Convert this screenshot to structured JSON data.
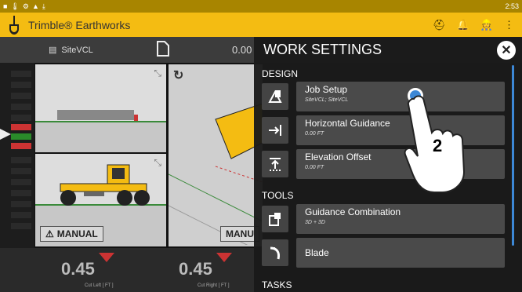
{
  "status": {
    "time": "2:53"
  },
  "app": {
    "title": "Trimble® Earthworks"
  },
  "toolbar": {
    "design_name": "SiteVCL",
    "value": "0.00"
  },
  "views": {
    "left_mode": "MANUAL",
    "right_mode": "MANU"
  },
  "bottom": {
    "cut_left": {
      "value": "0.45",
      "label": "Cut Left  [ FT ]"
    },
    "cut_right": {
      "value": "0.45",
      "label": "Cut Right  [ FT ]"
    }
  },
  "panel": {
    "title": "WORK SETTINGS",
    "sections": {
      "design": "DESIGN",
      "tools": "TOOLS",
      "tasks": "TASKS"
    },
    "items": [
      {
        "label": "Job Setup",
        "sub": "SiteVCL; SiteVCL",
        "icon": "job-setup-icon"
      },
      {
        "label": "Horizontal Guidance",
        "sub": "0.00 FT",
        "icon": "horizontal-guidance-icon"
      },
      {
        "label": "Elevation Offset",
        "sub": "0.00 FT",
        "icon": "elevation-offset-icon"
      },
      {
        "label": "Guidance Combination",
        "sub": "3D + 3D",
        "icon": "guidance-combination-icon"
      },
      {
        "label": "Blade",
        "sub": "",
        "icon": "blade-icon"
      }
    ]
  },
  "annotation": {
    "step": "2"
  },
  "colors": {
    "accent": "#f4bc12",
    "statusbar": "#a88500",
    "highlight": "#3d88d6"
  }
}
